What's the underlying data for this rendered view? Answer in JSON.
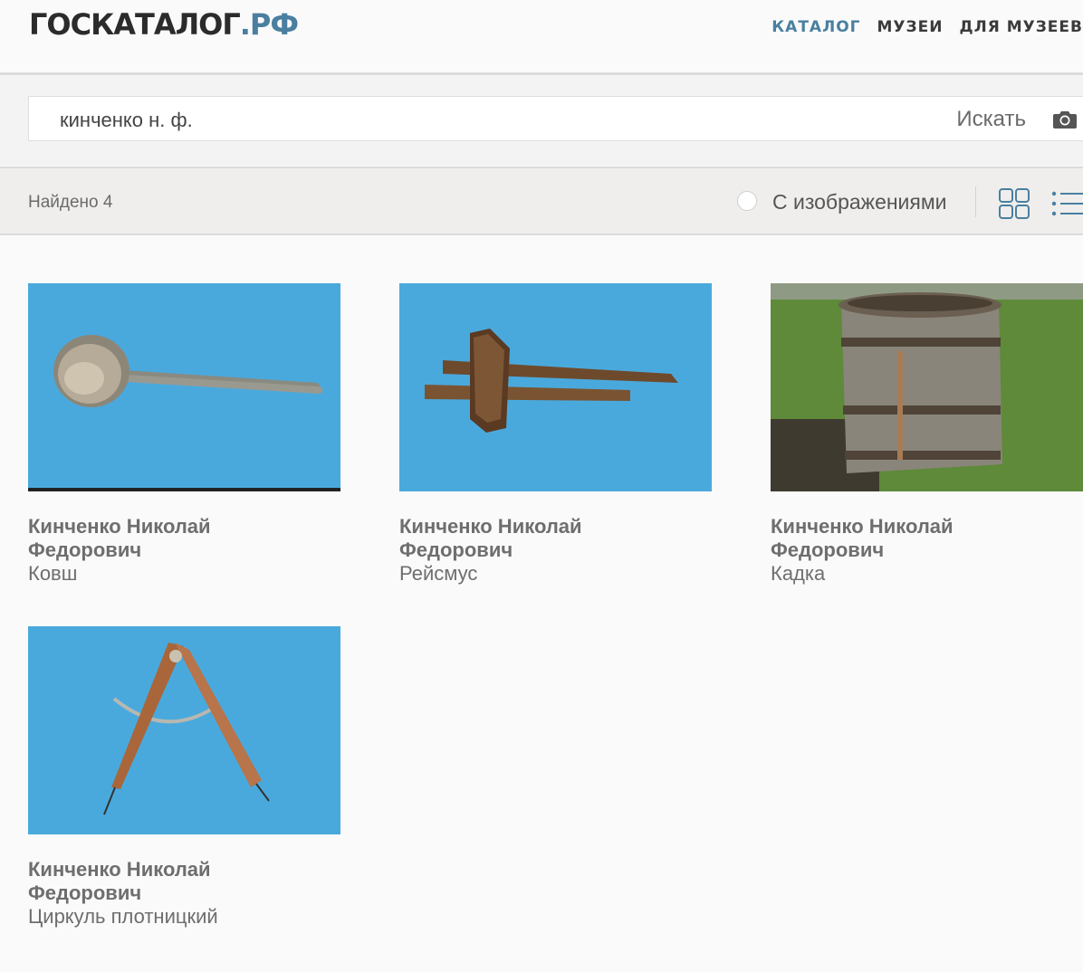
{
  "header": {
    "logo_main": "ГОСКАТАЛОГ",
    "logo_tld": ".РФ",
    "nav": [
      {
        "label": "КАТАЛОГ",
        "active": true
      },
      {
        "label": "МУЗЕИ",
        "active": false
      },
      {
        "label": "ДЛЯ МУЗЕЕВ",
        "active": false
      }
    ]
  },
  "search": {
    "value": "кинченко н. ф.",
    "button_label": "Искать",
    "camera_icon": "camera-icon"
  },
  "filters": {
    "found_text": "Найдено 4",
    "with_images_label": "С изображениями",
    "with_images_checked": false,
    "view_grid_icon": "grid-view-icon",
    "view_list_icon": "list-view-icon"
  },
  "results": [
    {
      "author_line1": "Кинченко Николай",
      "author_line2": "Федорович",
      "object": "Ковш"
    },
    {
      "author_line1": "Кинченко Николай",
      "author_line2": "Федорович",
      "object": "Рейсмус"
    },
    {
      "author_line1": "Кинченко Николай",
      "author_line2": "Федорович",
      "object": "Кадка"
    },
    {
      "author_line1": "Кинченко Николай",
      "author_line2": "Федорович",
      "object": "Циркуль плотницкий"
    }
  ],
  "colors": {
    "accent": "#4a7fa0",
    "photo_background_blue": "#4aa9dc",
    "grass_green": "#5e8a3a"
  }
}
